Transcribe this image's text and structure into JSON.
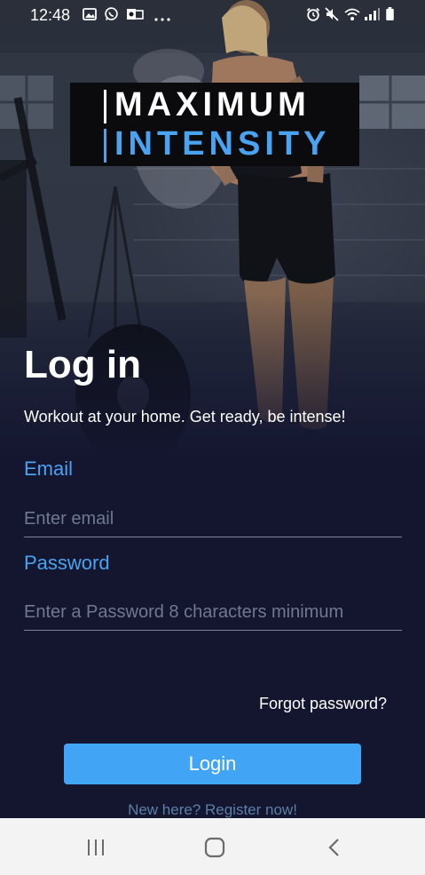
{
  "status_bar": {
    "time": "12:48",
    "left_icons": [
      "image-icon",
      "whatsapp-icon",
      "outlook-icon",
      "more-icon"
    ],
    "right_icons": [
      "alarm-icon",
      "mute-icon",
      "wifi-icon",
      "signal-icon",
      "battery-icon"
    ]
  },
  "logo": {
    "line1": "MAXIMUM",
    "line2": "INTENSITY",
    "accent_color": "#4aa3f0"
  },
  "login": {
    "title": "Log in",
    "subtitle": "Workout at your home. Get ready, be intense!"
  },
  "form": {
    "email_label": "Email",
    "email_placeholder": "Enter email",
    "email_value": "",
    "password_label": "Password",
    "password_placeholder": "Enter a Password 8 characters minimum",
    "password_value": ""
  },
  "actions": {
    "forgot_password": "Forgot password?",
    "login_button": "Login",
    "register_link": "New here? Register now!"
  },
  "nav_bar": {
    "buttons": [
      "recent-apps-icon",
      "home-icon",
      "back-icon"
    ]
  },
  "colors": {
    "background": "#141630",
    "accent": "#42a4f5",
    "label": "#4aa3f0",
    "placeholder": "#6f7a8e"
  }
}
